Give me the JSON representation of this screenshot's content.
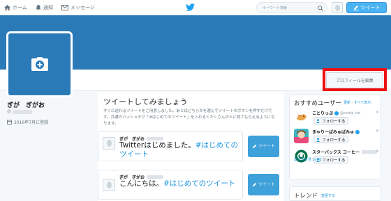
{
  "nav": {
    "home": "ホーム",
    "notifications": "通知",
    "messages": "メッセージ",
    "search_placeholder": "キーワード検索",
    "tweet_button": "ツイート"
  },
  "profile": {
    "name": "ぎが　ぎがお",
    "handle_prefix": "@",
    "joined": "2016年7月に登録",
    "edit_button": "プロフィールを編集"
  },
  "timeline": {
    "title": "ツイートしてみましょう",
    "description": "すぐに送れるツイートをご用意しました。あとはどちらかを選んでツイートのボタンを押すだけです。共通のハッシュタグ「#はじめてのツイート」を入れるとたくさんの人に見てもらえるようになります。",
    "cards": [
      {
        "name": "ぎが　ぎがお",
        "text": "Twitterはじめました。",
        "tag": "#はじめてのツイート",
        "button": "ツイート"
      },
      {
        "name": "ぎが　ぎがお",
        "text": "こんにちは。",
        "tag": "#はじめてのツイート",
        "button": "ツイート"
      }
    ]
  },
  "sidebar": {
    "title": "おすすめユーザー",
    "refresh": "更新",
    "separator": "·",
    "view_all": "すべて表示",
    "users": [
      {
        "name": "ことりっぷ",
        "handle": "@cotrip_twi",
        "follow": "フォローする",
        "close": "×"
      },
      {
        "name": "きゃりーぱみゅぱみゅ",
        "follow": "フォローする",
        "close": "×"
      },
      {
        "name": "スターバックス コーヒー",
        "follow": "フォローする",
        "close": "×"
      }
    ],
    "find_friends": "友だちを見つける"
  },
  "trends": {
    "title": "トレンド",
    "change": "変更する"
  },
  "colors": {
    "banner": "#2a7ab8",
    "accent": "#1b95e0",
    "highlight": "#ee1111",
    "tweet_button": "#3ea1d9"
  }
}
